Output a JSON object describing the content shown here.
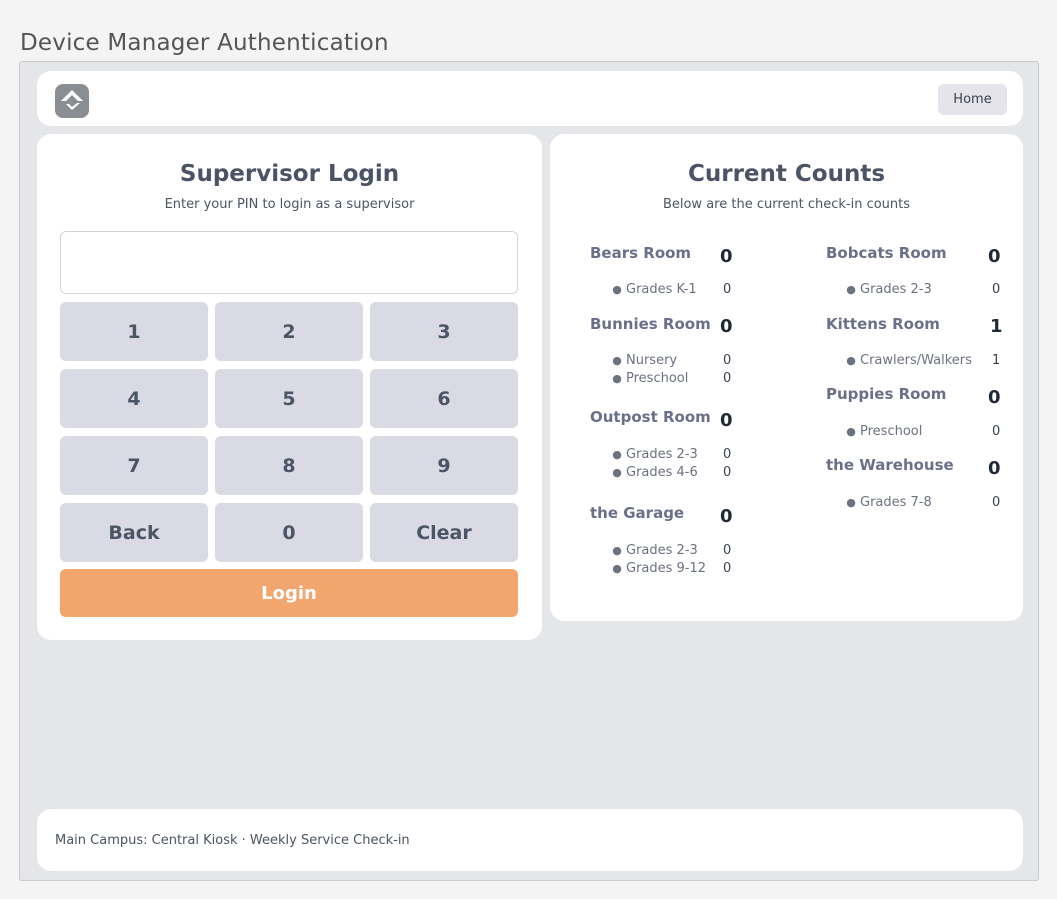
{
  "page": {
    "heading": "Device Manager Authentication"
  },
  "header": {
    "logo_icon": "rock-logo-icon",
    "home_label": "Home"
  },
  "login": {
    "title": "Supervisor Login",
    "subtitle": "Enter your PIN to login as a supervisor",
    "pin_value": "",
    "keys": [
      "1",
      "2",
      "3",
      "4",
      "5",
      "6",
      "7",
      "8",
      "9",
      "Back",
      "0",
      "Clear"
    ],
    "login_label": "Login",
    "login_color": "#f2a66e"
  },
  "counts": {
    "title": "Current Counts",
    "subtitle": "Below are the current check-in counts",
    "left_column": [
      {
        "name": "Bears Room",
        "count": "0",
        "groups": [
          {
            "name": "Grades K-1",
            "count": "0"
          }
        ]
      },
      {
        "name": "Bunnies Room",
        "count": "0",
        "groups": [
          {
            "name": "Nursery",
            "count": "0"
          },
          {
            "name": "Preschool",
            "count": "0"
          }
        ]
      },
      {
        "name": "Outpost Room",
        "count": "0",
        "groups": [
          {
            "name": "Grades 2-3",
            "count": "0"
          },
          {
            "name": "Grades 4-6",
            "count": "0"
          }
        ]
      },
      {
        "name": "the Garage",
        "count": "0",
        "groups": [
          {
            "name": "Grades 2-3",
            "count": "0"
          },
          {
            "name": "Grades 9-12",
            "count": "0"
          }
        ]
      }
    ],
    "right_column": [
      {
        "name": "Bobcats Room",
        "count": "0",
        "groups": [
          {
            "name": "Grades 2-3",
            "count": "0"
          }
        ]
      },
      {
        "name": "Kittens Room",
        "count": "1",
        "groups": [
          {
            "name": "Crawlers/Walkers",
            "count": "1"
          }
        ]
      },
      {
        "name": "Puppies Room",
        "count": "0",
        "groups": [
          {
            "name": "Preschool",
            "count": "0"
          }
        ]
      },
      {
        "name": "the Warehouse",
        "count": "0",
        "groups": [
          {
            "name": "Grades 7-8",
            "count": "0"
          }
        ]
      }
    ]
  },
  "footer": {
    "text": "Main Campus: Central Kiosk · Weekly Service Check-in"
  }
}
